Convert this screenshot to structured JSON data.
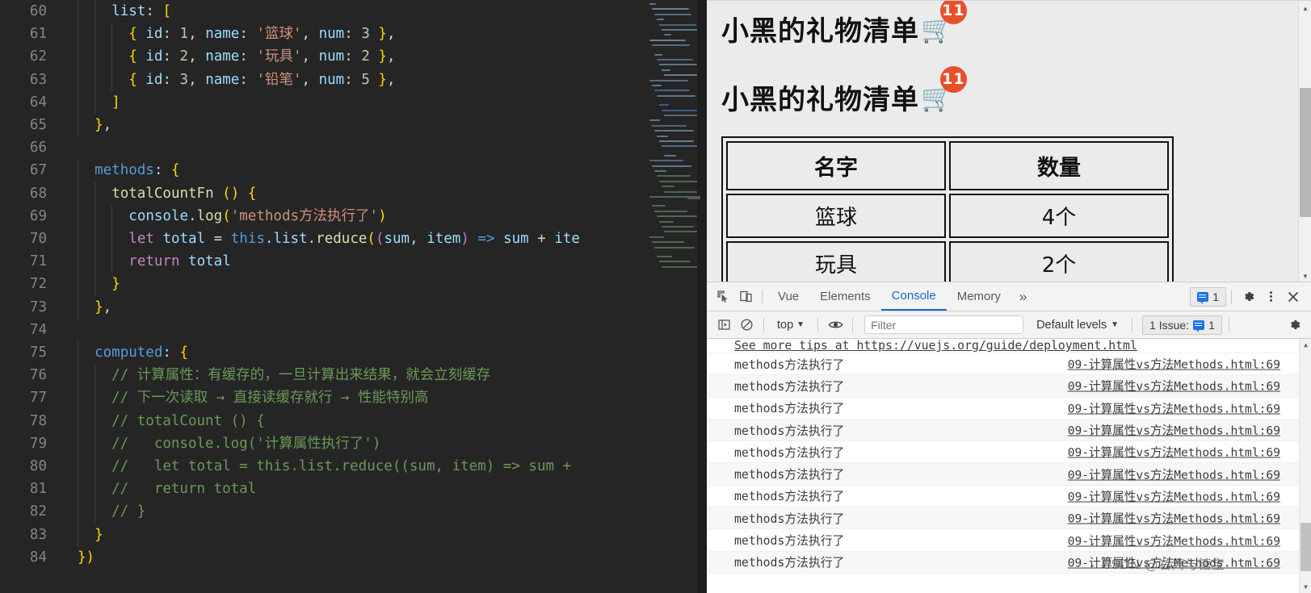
{
  "editor": {
    "first_line_number": 60,
    "lines": [
      {
        "num": 60,
        "text": "    list: [",
        "indent": 2
      },
      {
        "num": 61,
        "text": "      { id: 1, name: '篮球', num: 3 },",
        "indent": 3
      },
      {
        "num": 62,
        "text": "      { id: 2, name: '玩具', num: 2 },",
        "indent": 3
      },
      {
        "num": 63,
        "text": "      { id: 3, name: '铅笔', num: 5 },",
        "indent": 3
      },
      {
        "num": 64,
        "text": "    ]",
        "indent": 2
      },
      {
        "num": 65,
        "text": "  },",
        "indent": 1
      },
      {
        "num": 66,
        "text": "",
        "indent": 0
      },
      {
        "num": 67,
        "text": "  methods: {",
        "indent": 1
      },
      {
        "num": 68,
        "text": "    totalCountFn () {",
        "indent": 2
      },
      {
        "num": 69,
        "text": "      console.log('methods方法执行了')",
        "indent": 3
      },
      {
        "num": 70,
        "text": "      let total = this.list.reduce((sum, item) => sum + ite",
        "indent": 3
      },
      {
        "num": 71,
        "text": "      return total",
        "indent": 3
      },
      {
        "num": 72,
        "text": "    }",
        "indent": 2
      },
      {
        "num": 73,
        "text": "  },",
        "indent": 1
      },
      {
        "num": 74,
        "text": "",
        "indent": 0
      },
      {
        "num": 75,
        "text": "  computed: {",
        "indent": 1
      },
      {
        "num": 76,
        "text": "    // 计算属性：有缓存的，一旦计算出来结果，就会立刻缓存",
        "indent": 2
      },
      {
        "num": 77,
        "text": "    // 下一次读取 → 直接读缓存就行 → 性能特别高",
        "indent": 2
      },
      {
        "num": 78,
        "text": "    // totalCount () {",
        "indent": 2
      },
      {
        "num": 79,
        "text": "    //   console.log('计算属性执行了')",
        "indent": 2
      },
      {
        "num": 80,
        "text": "    //   let total = this.list.reduce((sum, item) => sum + ",
        "indent": 2
      },
      {
        "num": 81,
        "text": "    //   return total",
        "indent": 2
      },
      {
        "num": 82,
        "text": "    // }",
        "indent": 2
      },
      {
        "num": 83,
        "text": "  }",
        "indent": 1
      },
      {
        "num": 84,
        "text": "})",
        "indent": 0
      }
    ]
  },
  "browser_page": {
    "heading_1": "小黑的礼物清单",
    "heading_2": "小黑的礼物清单",
    "cart_icon": "shopping-cart-icon",
    "badge_1": "11",
    "badge_2": "11",
    "badge_color": "#e8502a",
    "table": {
      "headers": [
        "名字",
        "数量"
      ],
      "rows": [
        [
          "篮球",
          "4个"
        ],
        [
          "玩具",
          "2个"
        ]
      ]
    }
  },
  "devtools": {
    "inspect_icon": "inspect-element-icon",
    "device_icon": "device-toolbar-icon",
    "tabs": [
      {
        "label": "Vue",
        "active": false
      },
      {
        "label": "Elements",
        "active": false
      },
      {
        "label": "Console",
        "active": true
      },
      {
        "label": "Memory",
        "active": false
      }
    ],
    "more_tabs_icon": "chevron-double-right-icon",
    "message_count": "1",
    "settings_icon": "gear-icon",
    "kebab_icon": "more-vertical-icon",
    "close_icon": "close-icon",
    "accent_color": "#1967d2",
    "toolbar": {
      "sidebar_icon": "console-sidebar-icon",
      "clear_icon": "clear-console-icon",
      "context_label": "top",
      "eye_icon": "live-expression-icon",
      "filter_placeholder": "Filter",
      "filter_value": "",
      "levels_label": "Default levels",
      "issues_label": "1 Issue:",
      "issues_count": "1",
      "toolbar_gear_icon": "gear-icon"
    },
    "console": {
      "top_partial_message": "See more tips at https://vuejs.org/guide/deployment.html",
      "entries": [
        {
          "message": "methods方法执行了",
          "source": "09-计算属性vs方法Methods.html:69"
        },
        {
          "message": "methods方法执行了",
          "source": "09-计算属性vs方法Methods.html:69"
        },
        {
          "message": "methods方法执行了",
          "source": "09-计算属性vs方法Methods.html:69"
        },
        {
          "message": "methods方法执行了",
          "source": "09-计算属性vs方法Methods.html:69"
        },
        {
          "message": "methods方法执行了",
          "source": "09-计算属性vs方法Methods.html:69"
        },
        {
          "message": "methods方法执行了",
          "source": "09-计算属性vs方法Methods.html:69"
        },
        {
          "message": "methods方法执行了",
          "source": "09-计算属性vs方法Methods.html:69"
        },
        {
          "message": "methods方法执行了",
          "source": "09-计算属性vs方法Methods.html:69"
        },
        {
          "message": "methods方法执行了",
          "source": "09-计算属性vs方法Methods.html:69"
        },
        {
          "message": "methods方法执行了",
          "source": "09-计算属性vs方法Methods.html:69"
        }
      ]
    }
  },
  "watermark": "CSDN @右离与糖宝"
}
